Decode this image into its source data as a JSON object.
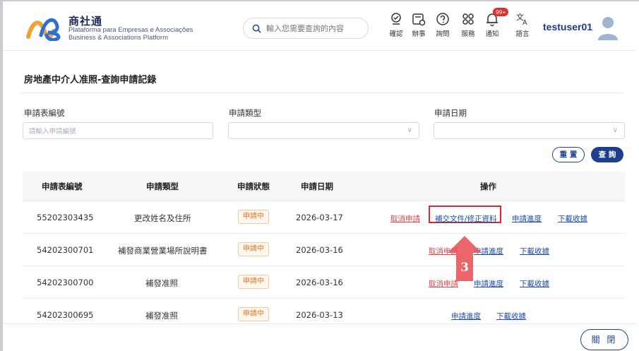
{
  "header": {
    "brand_name": "商社通",
    "brand_sub1": "Plataforma para Empresas e Associações",
    "brand_sub2": "Business & Associations Platform",
    "search_placeholder": "輸入您需要查詢的內容",
    "nav": [
      {
        "label": "確認",
        "icon": "confirm-icon"
      },
      {
        "label": "辦事",
        "icon": "task-icon"
      },
      {
        "label": "詢問",
        "icon": "question-icon"
      },
      {
        "label": "服務",
        "icon": "service-icon"
      },
      {
        "label": "通知",
        "icon": "bell-icon"
      },
      {
        "label": "語言",
        "icon": "language-icon"
      }
    ],
    "notification_badge": "99+",
    "username": "testuser01"
  },
  "page": {
    "title": "房地產中介人准照-查詢申請記錄"
  },
  "filters": {
    "form_no_label": "申請表編號",
    "form_no_placeholder": "請輸入申請編號",
    "type_label": "申請類型",
    "date_label": "申請日期",
    "reset_label": "重 置",
    "search_label": "查 詢"
  },
  "table": {
    "headers": [
      "申請表編號",
      "申請類型",
      "申請狀態",
      "申請日期",
      "操作"
    ],
    "rows": [
      {
        "no": "55202303435",
        "type": "更改姓名及住所",
        "status": "申請中",
        "date": "2026-03-17",
        "ops": [
          "取消申請",
          "補交文件/修正資料",
          "申請進度",
          "下載收據"
        ]
      },
      {
        "no": "54202300701",
        "type": "補發商業營業場所說明書",
        "status": "申請中",
        "date": "2026-03-16",
        "ops": [
          "取消申請",
          "申請進度",
          "下載收據"
        ]
      },
      {
        "no": "54202300700",
        "type": "補發准照",
        "status": "申請中",
        "date": "2026-03-16",
        "ops": [
          "取消申請",
          "申請進度",
          "下載收據"
        ]
      },
      {
        "no": "54202300695",
        "type": "補發准照",
        "status": "申請中",
        "date": "2026-03-13",
        "ops": [
          "申請進度",
          "下載收據"
        ]
      }
    ]
  },
  "annotation": {
    "step_number": "3",
    "color": "#e8595f"
  },
  "footer": {
    "close_label": "關 閉"
  },
  "colors": {
    "primary": "#1f3f8e",
    "status_orange": "#e17723",
    "cancel_red": "#e0454b",
    "highlight_red": "#e0262c"
  }
}
